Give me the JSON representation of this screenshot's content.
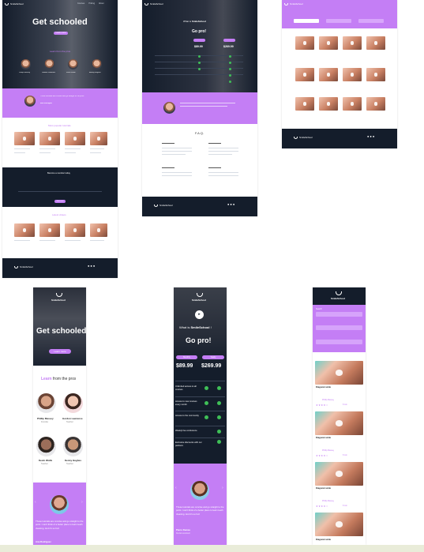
{
  "brand": {
    "name": "SmileSchool"
  },
  "desktop_home": {
    "nav": [
      "Courses",
      "Pricing",
      "About",
      "Login"
    ],
    "hero_title": "Get schooled",
    "hero_button": "Learn more",
    "hero_subtitle": "Learn from the pros",
    "instructors": [
      {
        "name": "Phillip Massey",
        "role": "Founder"
      },
      {
        "name": "Gordon Lawrence",
        "role": "Teacher"
      },
      {
        "name": "Kevin Wolfe",
        "role": "Teacher"
      },
      {
        "name": "Ashley Hughes",
        "role": "Teacher"
      }
    ],
    "quote_text": "Those tutorials are concise and go straight to the point.",
    "quote_author": "Ana Rodriguez",
    "popular_title": "Most popular tutorials",
    "membership_title": "Become a member today",
    "membership_button": "Join now",
    "latest_title": "Latest videos"
  },
  "desktop_pricing": {
    "what_is": "What is",
    "brand_word": "SmileSchool",
    "go_pro": "Go pro!",
    "plan_monthly_label": "Monthly",
    "plan_yearly_label": "Yearly",
    "price_monthly": "$89.99",
    "price_yearly": "$269.99",
    "faq_title": "F.A.Q."
  },
  "mobile_home": {
    "hero_title": "Get schooled",
    "hero_button": "Learn more",
    "learn_word": "Learn",
    "learn_rest": " from the pros",
    "instructors": [
      {
        "name": "Phillip Massey",
        "role": "Founder"
      },
      {
        "name": "Gordon Lawrence",
        "role": "Teacher"
      },
      {
        "name": "Kevin Wolfe",
        "role": "Teacher"
      },
      {
        "name": "Kenny Hughes",
        "role": "Teacher"
      }
    ],
    "quote_text": "Those tutorials are concise and go straight to the point. I can't think of a better place to learn teeth cleaning. And it's so fun!",
    "quote_author": "Ana Rodriguez"
  },
  "mobile_pricing": {
    "what_is": "What is",
    "brand_word": "SmileSchool",
    "go_pro": "Go pro!",
    "plan_monthly_label": "Monthly",
    "plan_yearly_label": "Yearly",
    "price_monthly": "$89.99",
    "price_yearly": "$269.99",
    "features": [
      "Unlimited access to all courses",
      "Access to new courses every month",
      "Access to the community",
      "Weekly live conference",
      "Exclusive discounts with our partners"
    ],
    "quote_text": "Those tutorials are concise and go straight to the point. I can't think of a better place to learn teeth cleaning. And it's so fun!",
    "quote_author": "Pierre Dumas",
    "quote_role": "Dental assistant"
  },
  "mobile_courses": {
    "section_label": "Search",
    "cards": [
      {
        "title": "Diagonal smile",
        "author": "Phillip Massey",
        "duration": "8 min"
      },
      {
        "title": "Diagonal smile",
        "author": "Phillip Massey",
        "duration": "8 min"
      },
      {
        "title": "Diagonal smile",
        "author": "Phillip Massey",
        "duration": "8 min"
      },
      {
        "title": "Diagonal smile",
        "author": "Phillip Massey",
        "duration": "8 min"
      }
    ]
  },
  "colors": {
    "accent": "#c47ef5",
    "dark": "#141d2b",
    "check": "#3fbf57"
  }
}
